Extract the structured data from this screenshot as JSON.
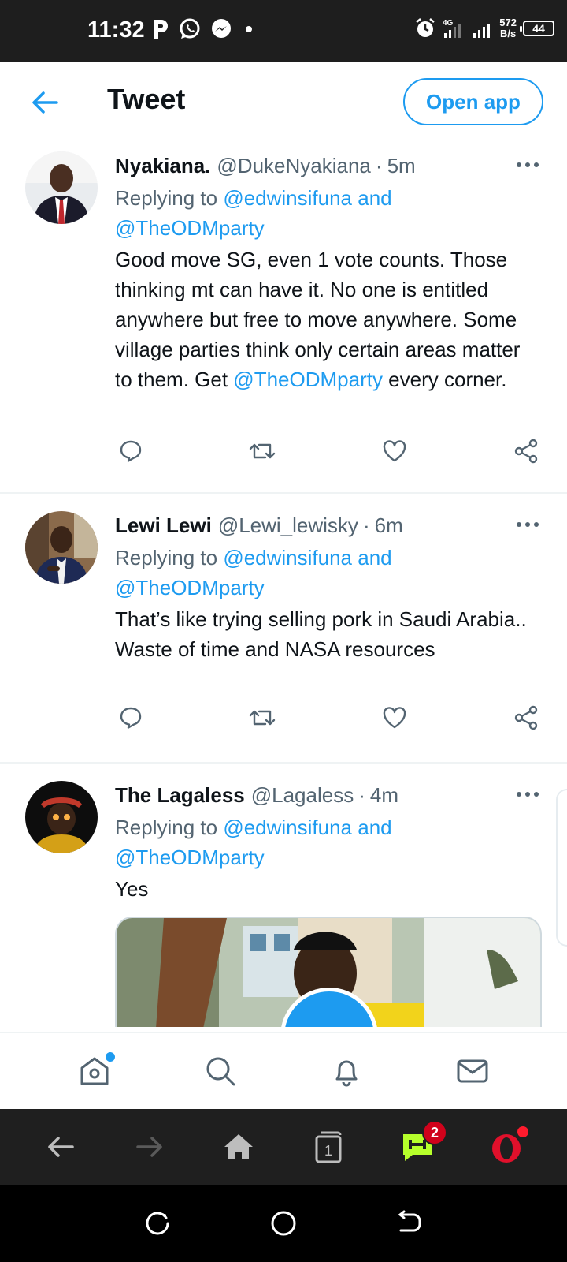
{
  "status_bar": {
    "time": "11:32",
    "left_icons": [
      "parking-icon",
      "whatsapp-icon",
      "messenger-icon",
      "dot-icon"
    ],
    "network": "4G",
    "speed_value": "572",
    "speed_unit": "B/s",
    "battery": "44"
  },
  "header": {
    "title": "Tweet",
    "open_app_label": "Open app"
  },
  "tweets": [
    {
      "name": "Nyakiana.",
      "handle": "@DukeNyakiana",
      "time": "5m",
      "replying_prefix": "Replying to ",
      "replying_to_1": "@edwinsifuna",
      "replying_and": " and",
      "replying_to_2": "@TheODMparty",
      "text_before": "Good move SG, even 1 vote counts. Those thinking mt can have it. No one is entitled anywhere but free to move anywhere. Some village parties think only certain areas matter to them. Get ",
      "text_mention": "@TheODMparty",
      "text_after": " every corner."
    },
    {
      "name": "Lewi Lewi",
      "handle": "@Lewi_lewisky",
      "time": "6m",
      "replying_prefix": "Replying to ",
      "replying_to_1": "@edwinsifuna",
      "replying_and": " and",
      "replying_to_2": "@TheODMparty",
      "text": "That’s like trying selling pork in Saudi Arabia..\nWaste of time and NASA resources"
    },
    {
      "name": "The Lagaless",
      "handle": "@Lagaless",
      "time": "4m",
      "replying_prefix": "Replying to ",
      "replying_to_1": "@edwinsifuna",
      "replying_and": " and",
      "replying_to_2": "@TheODMparty",
      "text": "Yes"
    }
  ],
  "separator": "·",
  "bottom_nav": [
    "home-icon",
    "search-icon",
    "notifications-icon",
    "messages-icon"
  ],
  "browser_bar": {
    "tab_count": "1",
    "games_badge": "2"
  },
  "colors": {
    "accent": "#1d9bf0",
    "text": "#0f1419",
    "secondary": "#536471"
  }
}
